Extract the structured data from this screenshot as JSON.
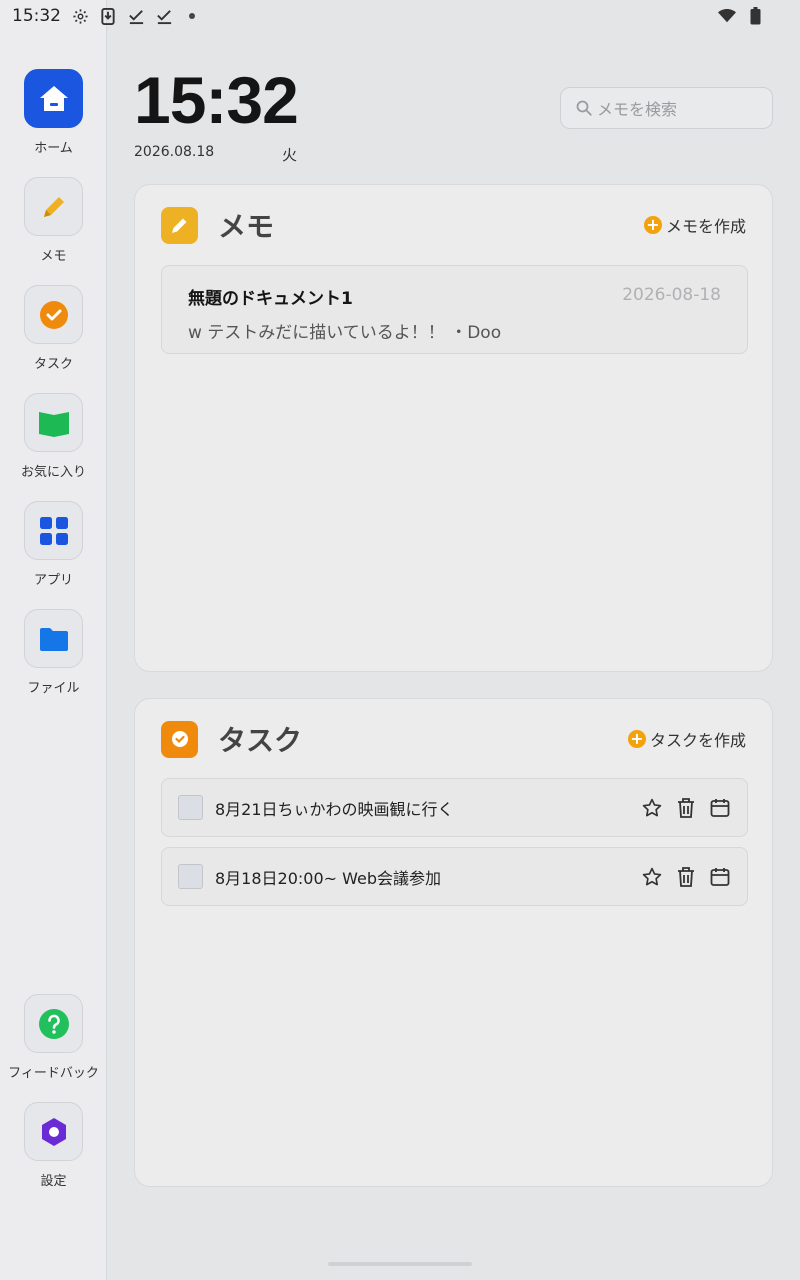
{
  "status_bar": {
    "time": "15:32"
  },
  "sidebar": {
    "items": [
      {
        "label": "ホーム",
        "icon": "home-icon",
        "active": true
      },
      {
        "label": "メモ",
        "icon": "pencil-icon"
      },
      {
        "label": "タスク",
        "icon": "check-circle-icon"
      },
      {
        "label": "お気に入り",
        "icon": "book-icon"
      },
      {
        "label": "アプリ",
        "icon": "grid-icon"
      },
      {
        "label": "ファイル",
        "icon": "folder-icon"
      },
      {
        "label": "フィードバック",
        "icon": "help-icon"
      },
      {
        "label": "設定",
        "icon": "hexagon-settings-icon"
      }
    ]
  },
  "header": {
    "clock": "15:32",
    "date": "2026.08.18",
    "weekday": "火",
    "search_placeholder": "メモを検索"
  },
  "memo_card": {
    "title": "メモ",
    "create_label": "メモを作成",
    "items": [
      {
        "title": "無題のドキュメント1",
        "date": "2026-08-18",
        "preview": "w テストみだに描いているよ！！ ・Doo"
      }
    ]
  },
  "task_card": {
    "title": "タスク",
    "create_label": "タスクを作成",
    "items": [
      {
        "text": "8月21日ちぃかわの映画観に行く",
        "done": false
      },
      {
        "text": "8月18日20:00~ Web会議参加",
        "done": false
      }
    ]
  },
  "colors": {
    "accent_blue": "#1a56e0",
    "memo_yellow": "#efb124",
    "task_orange": "#f08a0c",
    "book_green": "#1db954",
    "help_green": "#21c05d",
    "settings_purple": "#6a2bd6"
  }
}
